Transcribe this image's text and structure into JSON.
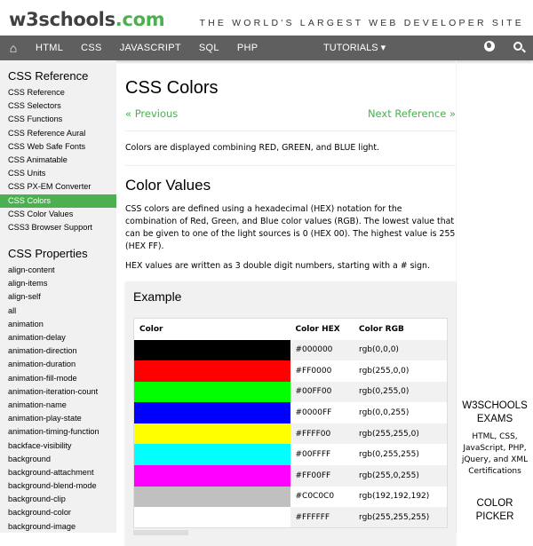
{
  "header": {
    "logo_main": "w3schools",
    "logo_tld": ".com",
    "tagline": "THE WORLD'S LARGEST WEB DEVELOPER SITE"
  },
  "navbar": {
    "items": [
      "HTML",
      "CSS",
      "JAVASCRIPT",
      "SQL",
      "PHP"
    ],
    "tutorials": "TUTORIALS ▾",
    "home_icon": "home-icon",
    "globe_icon": "globe-icon",
    "search_icon": "search-icon"
  },
  "sidebar": {
    "section1_title": "CSS Reference",
    "section1_items": [
      "CSS Reference",
      "CSS Selectors",
      "CSS Functions",
      "CSS Reference Aural",
      "CSS Web Safe Fonts",
      "CSS Animatable",
      "CSS Units",
      "CSS PX-EM Converter",
      "CSS Colors",
      "CSS Color Values",
      "CSS3 Browser Support"
    ],
    "active_item": "CSS Colors",
    "section2_title": "CSS Properties",
    "section2_items": [
      "align-content",
      "align-items",
      "align-self",
      "all",
      "animation",
      "animation-delay",
      "animation-direction",
      "animation-duration",
      "animation-fill-mode",
      "animation-iteration-count",
      "animation-name",
      "animation-play-state",
      "animation-timing-function",
      "backface-visibility",
      "background",
      "background-attachment",
      "background-blend-mode",
      "background-clip",
      "background-color",
      "background-image"
    ]
  },
  "main": {
    "title": "CSS Colors",
    "prev_label": "« Previous",
    "next_label": "Next Reference »",
    "intro": "Colors are displayed combining RED, GREEN, and BLUE light.",
    "section_title": "Color Values",
    "para1": "CSS colors are defined using a hexadecimal (HEX) notation for the combination of Red, Green, and Blue color values (RGB). The lowest value that can be given to one of the light sources is 0 (HEX 00). The highest value is 255 (HEX FF).",
    "para2": "HEX values are written as 3 double digit numbers, starting with a # sign.",
    "example_title": "Example",
    "table": {
      "headers": [
        "Color",
        "Color HEX",
        "Color RGB"
      ],
      "rows": [
        {
          "swatch": "#000000",
          "hex": "#000000",
          "rgb": "rgb(0,0,0)"
        },
        {
          "swatch": "#FF0000",
          "hex": "#FF0000",
          "rgb": "rgb(255,0,0)"
        },
        {
          "swatch": "#00FF00",
          "hex": "#00FF00",
          "rgb": "rgb(0,255,0)"
        },
        {
          "swatch": "#0000FF",
          "hex": "#0000FF",
          "rgb": "rgb(0,0,255)"
        },
        {
          "swatch": "#FFFF00",
          "hex": "#FFFF00",
          "rgb": "rgb(255,255,0)"
        },
        {
          "swatch": "#00FFFF",
          "hex": "#00FFFF",
          "rgb": "rgb(0,255,255)"
        },
        {
          "swatch": "#FF00FF",
          "hex": "#FF00FF",
          "rgb": "rgb(255,0,255)"
        },
        {
          "swatch": "#C0C0C0",
          "hex": "#C0C0C0",
          "rgb": "rgb(192,192,192)"
        },
        {
          "swatch": "#FFFFFF",
          "hex": "#FFFFFF",
          "rgb": "rgb(255,255,255)"
        }
      ]
    }
  },
  "right_column": {
    "exams_title": "W3SCHOOLS EXAMS",
    "exams_text": "HTML, CSS, JavaScript, PHP, jQuery, and XML Certifications",
    "picker_title": "COLOR PICKER"
  },
  "colors": {
    "accent": "#4CAF50",
    "navbar": "#5f5f5f",
    "sidebar": "#f1f1f1"
  }
}
